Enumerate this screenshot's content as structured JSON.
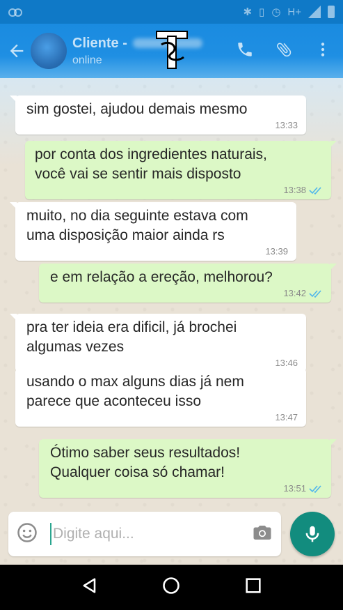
{
  "status_bar": {
    "network": "H+"
  },
  "header": {
    "contact_name": "Cliente -",
    "contact_status": "online",
    "icons": [
      "back-arrow-icon",
      "phone-icon",
      "paperclip-icon",
      "more-vert-icon"
    ]
  },
  "messages": [
    {
      "direction": "in",
      "text_lines": [
        "sim gostei, ajudou demais mesmo"
      ],
      "time": "13:33"
    },
    {
      "direction": "out",
      "text_lines": [
        "por conta dos ingredientes naturais,",
        "você vai se sentir mais disposto"
      ],
      "time": "13:38",
      "read": true
    },
    {
      "direction": "in",
      "text_lines": [
        "muito, no dia seguinte estava com",
        "uma disposição maior ainda rs"
      ],
      "time": "13:39"
    },
    {
      "direction": "out",
      "text_lines": [
        "e em relação a ereção, melhorou?"
      ],
      "time": "13:42",
      "read": true
    },
    {
      "direction": "in",
      "text_lines": [
        "pra ter ideia era dificil, já brochei",
        "algumas vezes"
      ],
      "time": "13:46"
    },
    {
      "direction": "in",
      "text_lines": [
        "usando o max alguns dias já nem",
        "parece que aconteceu isso"
      ],
      "time": "13:47"
    },
    {
      "direction": "out",
      "text_lines": [
        "Ótimo saber seus resultados!",
        "Qualquer coisa só chamar!"
      ],
      "time": "13:51",
      "read": true
    }
  ],
  "composer": {
    "placeholder": "Digite aqui..."
  },
  "colors": {
    "header_blue": "#1f8fe3",
    "outgoing_bubble": "#dcf8c6",
    "incoming_bubble": "#ffffff",
    "read_tick": "#4fb6ec",
    "mic_button": "#128c7e"
  }
}
